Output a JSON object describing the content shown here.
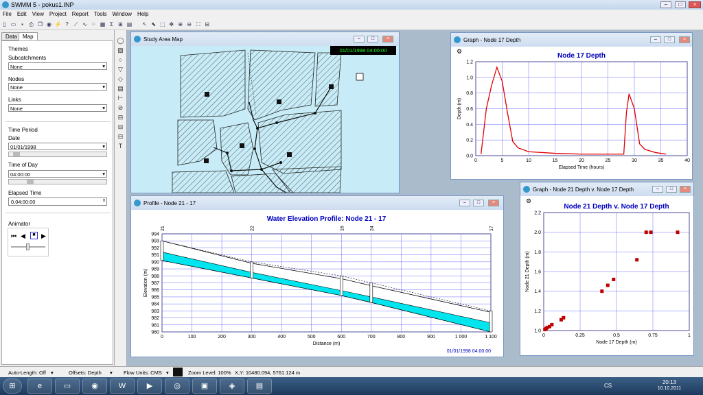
{
  "app": {
    "title": "SWMM 5 - pokus1.INP"
  },
  "menu": [
    "File",
    "Edit",
    "View",
    "Project",
    "Report",
    "Tools",
    "Window",
    "Help"
  ],
  "left": {
    "tabs": [
      "Data",
      "Map"
    ],
    "themes": "Themes",
    "subcatch_label": "Subcatchments",
    "subcatch_value": "None",
    "nodes_label": "Nodes",
    "nodes_value": "None",
    "links_label": "Links",
    "links_value": "None",
    "time_period": "Time Period",
    "date_label": "Date",
    "date_value": "01/01/1998",
    "tod_label": "Time of Day",
    "tod_value": "04:00:00",
    "elapsed_label": "Elapsed Time",
    "elapsed_value": "0.04:00:00",
    "animator": "Animator"
  },
  "map": {
    "title": "Study Area Map",
    "datetime": "01/01/1998 04:00:00"
  },
  "graph1": {
    "title": "Graph - Node 17 Depth",
    "chart_title": "Node 17 Depth",
    "xlabel": "Elapsed Time (hours)",
    "ylabel": "Depth (m)",
    "xticks": [
      "0",
      "5",
      "10",
      "15",
      "20",
      "25",
      "30",
      "35",
      "40"
    ],
    "yticks": [
      "0.0",
      "0.2",
      "0.4",
      "0.6",
      "0.8",
      "1.0",
      "1.2"
    ]
  },
  "graph2": {
    "title": "Graph - Node 21 Depth v. Node 17 Depth",
    "chart_title": "Node 21 Depth v. Node 17 Depth",
    "xlabel": "Node 17 Depth (m)",
    "ylabel": "Node 21 Depth (m)",
    "xticks": [
      "0",
      "0.25",
      "0.5",
      "0.75",
      "1"
    ],
    "yticks": [
      "1.0",
      "1.2",
      "1.4",
      "1.6",
      "1.8",
      "2.0",
      "2.2"
    ]
  },
  "profile": {
    "title": "Profile - Node 21 - 17",
    "chart_title": "Water Elevation Profile:  Node 21 - 17",
    "xlabel": "Distance (m)",
    "ylabel": "Elevation (m)",
    "xticks": [
      "0",
      "100",
      "200",
      "300",
      "400",
      "500",
      "600",
      "700",
      "800",
      "900",
      "1 000",
      "1 100"
    ],
    "yticks": [
      "980",
      "981",
      "982",
      "983",
      "984",
      "985",
      "986",
      "987",
      "988",
      "989",
      "990",
      "991",
      "992",
      "993",
      "994"
    ],
    "node_labels": [
      "21",
      "22",
      "16",
      "24",
      "17"
    ],
    "datetime": "01/01/1998 04:00:00"
  },
  "status": {
    "autolength": "Auto-Length: Off",
    "offsets": "Offsets: Depth",
    "flow_units": "Flow Units: CMS",
    "zoom": "Zoom Level: 100%",
    "xy": "X,Y: 10480.094, 5761.124 m"
  },
  "taskbar": {
    "lang": "CS",
    "time": "20:13",
    "date": "10.10.2011"
  },
  "colors": {
    "series_red": "#e00000",
    "water": "#00e5ee",
    "map_bg": "#c7ecf7",
    "chart_title": "#0000c0"
  },
  "chart_data": [
    {
      "type": "line",
      "title": "Node 17 Depth",
      "xlabel": "Elapsed Time (hours)",
      "ylabel": "Depth (m)",
      "xlim": [
        0,
        40
      ],
      "ylim": [
        0,
        1.2
      ],
      "grid": true,
      "series": [
        {
          "x": [
            1,
            2,
            3,
            4,
            5,
            6,
            7,
            8,
            10,
            15,
            20,
            25,
            28,
            28.5,
            29,
            30,
            31,
            32,
            34,
            36
          ],
          "y": [
            0.02,
            0.6,
            0.9,
            1.13,
            0.95,
            0.55,
            0.18,
            0.1,
            0.05,
            0.03,
            0.02,
            0.02,
            0.02,
            0.55,
            0.79,
            0.6,
            0.15,
            0.08,
            0.04,
            0.02
          ]
        }
      ]
    },
    {
      "type": "scatter",
      "title": "Node 21 Depth v. Node 17 Depth",
      "xlabel": "Node 17 Depth (m)",
      "ylabel": "Node 21 Depth (m)",
      "xlim": [
        0,
        1.25
      ],
      "ylim": [
        1.0,
        2.2
      ],
      "grid": true,
      "series": [
        {
          "x": [
            0.01,
            0.02,
            0.03,
            0.05,
            0.07,
            0.15,
            0.17,
            0.5,
            0.55,
            0.6,
            0.8,
            0.88,
            0.92,
            1.15
          ],
          "y": [
            1.01,
            1.02,
            1.03,
            1.04,
            1.06,
            1.11,
            1.13,
            1.4,
            1.46,
            1.52,
            1.72,
            2.0,
            2.0,
            2.0
          ]
        }
      ]
    },
    {
      "type": "area",
      "title": "Water Elevation Profile:  Node 21 - 17",
      "xlabel": "Distance (m)",
      "ylabel": "Elevation (m)",
      "xlim": [
        0,
        1100
      ],
      "ylim": [
        980,
        994
      ],
      "grid": true,
      "series": [
        {
          "name": "invert",
          "x": [
            0,
            300,
            600,
            700,
            1100
          ],
          "y": [
            990.2,
            987.7,
            985.2,
            984.2,
            980.0
          ]
        },
        {
          "name": "water",
          "x": [
            0,
            300,
            600,
            700,
            1100
          ],
          "y": [
            991.4,
            988.5,
            985.9,
            985.0,
            981.3
          ]
        },
        {
          "name": "crown",
          "x": [
            0,
            300,
            600,
            700,
            1100
          ],
          "y": [
            993.0,
            989.8,
            987.6,
            986.6,
            982.8
          ]
        },
        {
          "name": "ground",
          "x": [
            0,
            300,
            600,
            700,
            1100
          ],
          "y": [
            993.0,
            990.0,
            988.0,
            987.0,
            983.0
          ]
        }
      ]
    }
  ]
}
